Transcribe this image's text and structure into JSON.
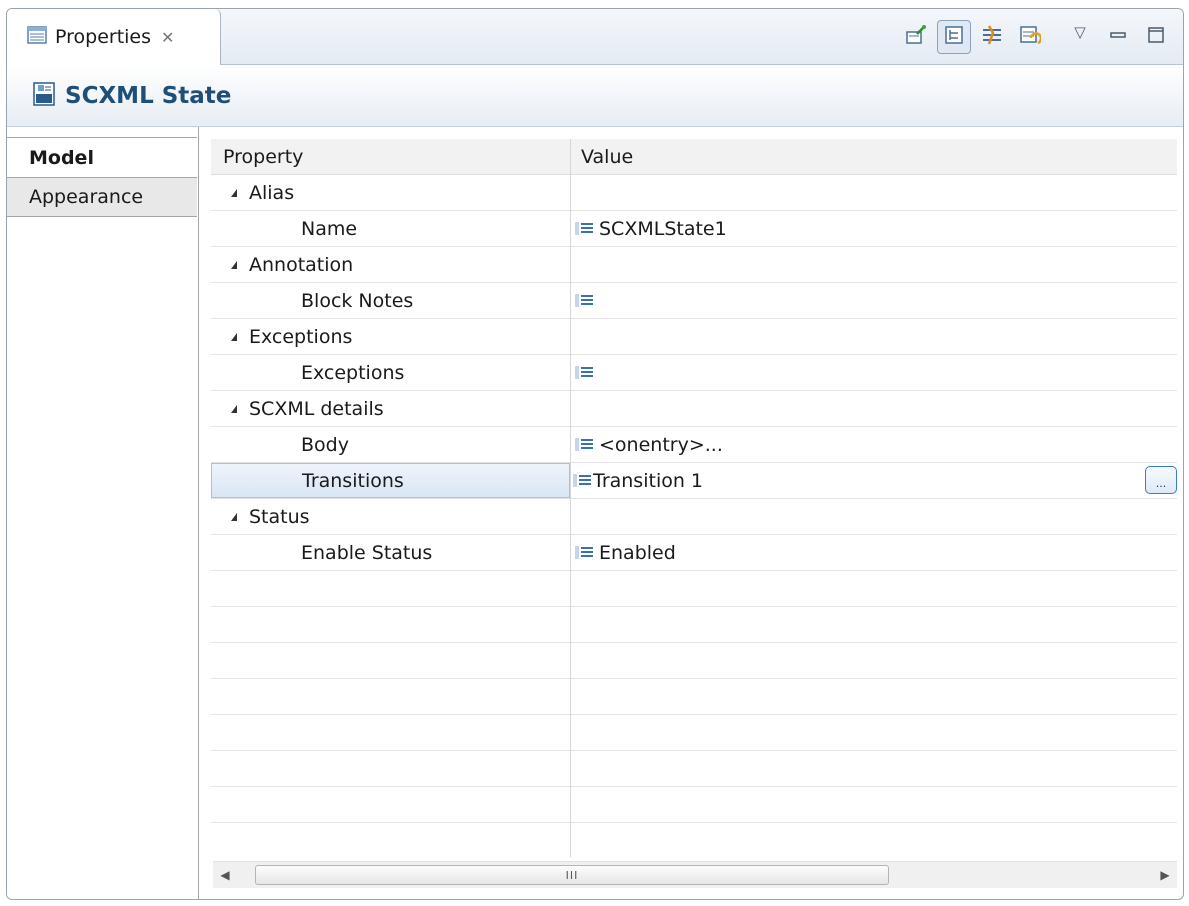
{
  "view": {
    "title": "Properties",
    "close_glyph": "✕"
  },
  "toolbar": {
    "buttons": [
      "pin-editor-icon",
      "show-categories-icon",
      "show-advanced-icon",
      "restore-default-icon"
    ],
    "menu_glyph": "▽",
    "minimize_glyph": "▭",
    "maximize_glyph": "□"
  },
  "header": {
    "icon": "scxml-icon",
    "title": "SCXML State"
  },
  "side_tabs": {
    "model": "Model",
    "appearance": "Appearance"
  },
  "grid": {
    "col_property": "Property",
    "col_value": "Value",
    "rows": [
      {
        "label": "Alias",
        "value": ""
      },
      {
        "label": "Name",
        "value": "SCXMLState1"
      },
      {
        "label": "Annotation",
        "value": ""
      },
      {
        "label": "Block Notes",
        "value": ""
      },
      {
        "label": "Exceptions",
        "value": ""
      },
      {
        "label": "Exceptions",
        "value": ""
      },
      {
        "label": "SCXML details",
        "value": ""
      },
      {
        "label": "Body",
        "value": "<onentry>..."
      },
      {
        "label": "Transitions",
        "value": "Transition 1"
      },
      {
        "label": "Status",
        "value": ""
      },
      {
        "label": "Enable Status",
        "value": "Enabled"
      }
    ],
    "ellipsis_label": "..."
  },
  "scrollbar": {
    "thumb_grip": "III",
    "left_glyph": "◀",
    "right_glyph": "▶"
  },
  "colors": {
    "header_title": "#1f4e79",
    "selection": "#d9e6f5",
    "accent": "#3a7bd5"
  }
}
